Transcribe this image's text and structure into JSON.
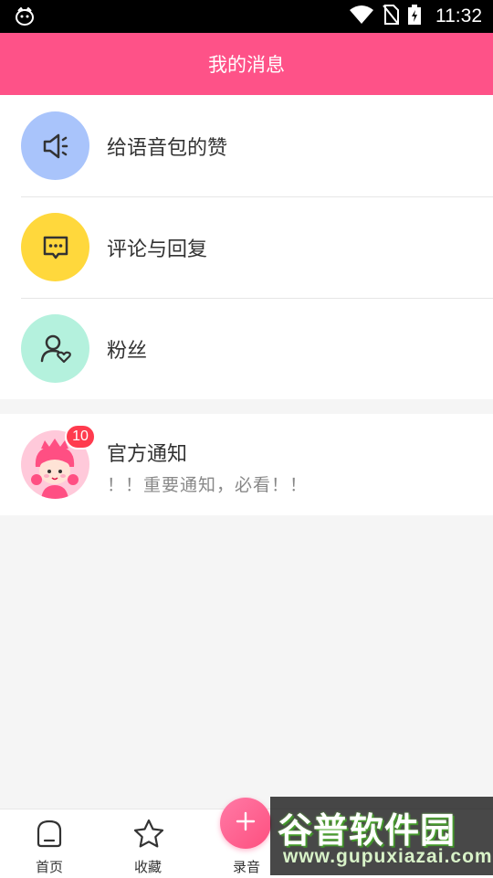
{
  "status_bar": {
    "time": "11:32"
  },
  "header": {
    "title": "我的消息"
  },
  "menu": [
    {
      "label": "给语音包的赞",
      "icon": "speaker-icon",
      "color": "#a9c4fb"
    },
    {
      "label": "评论与回复",
      "icon": "comment-icon",
      "color": "#ffd83c"
    },
    {
      "label": "粉丝",
      "icon": "fan-icon",
      "color": "#b4f1dd"
    }
  ],
  "official_notice": {
    "title": "官方通知",
    "preview": "！！重要通知，必看！！",
    "badge": "10"
  },
  "tabs": [
    {
      "label": "首页",
      "icon": "home-icon"
    },
    {
      "label": "收藏",
      "icon": "star-icon"
    },
    {
      "label": "录音",
      "icon": "plus-icon"
    }
  ],
  "watermark": {
    "main": "谷普软件园",
    "url": "www.gupuxiazai.com"
  },
  "colors": {
    "brand": "#fe5288",
    "badge": "#ff3b4e"
  }
}
